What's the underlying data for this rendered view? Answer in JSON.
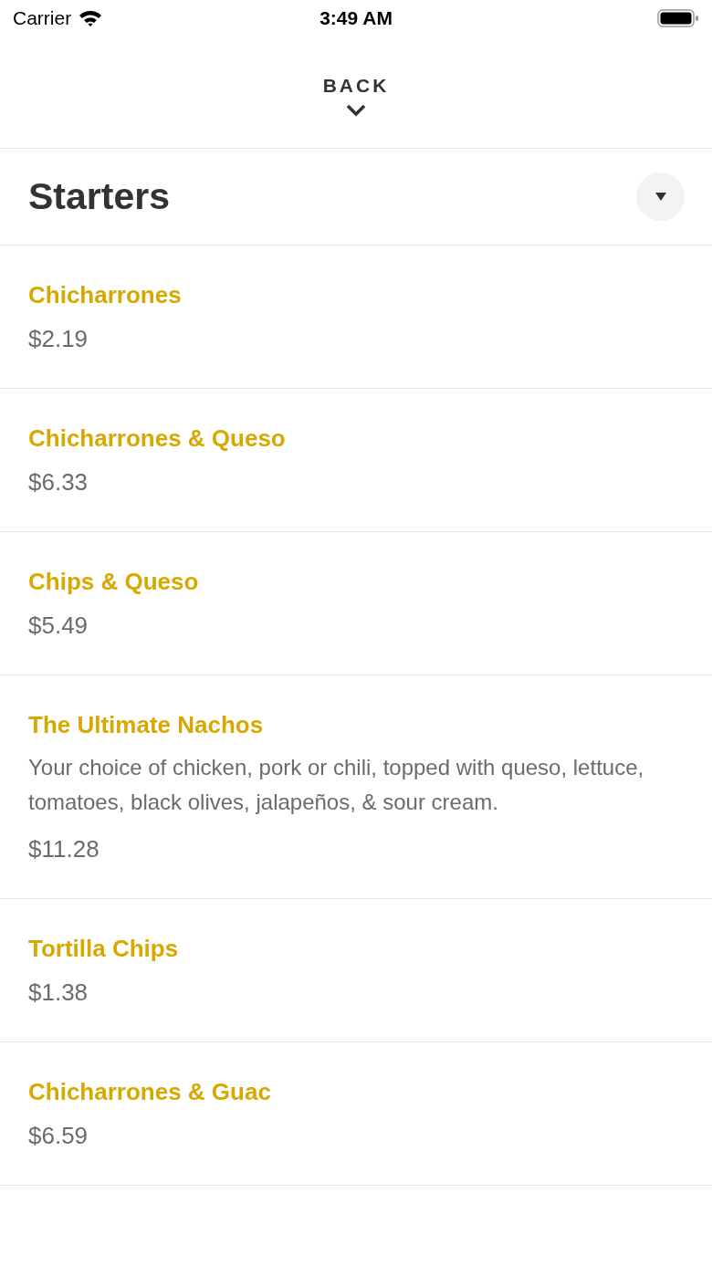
{
  "status_bar": {
    "carrier": "Carrier",
    "time": "3:49 AM"
  },
  "nav": {
    "back_label": "BACK"
  },
  "section": {
    "title": "Starters",
    "expanded": false
  },
  "items": [
    {
      "name": "Chicharrones",
      "price": "$2.19"
    },
    {
      "name": "Chicharrones & Queso",
      "price": "$6.33"
    },
    {
      "name": "Chips & Queso",
      "price": "$5.49"
    },
    {
      "name": "The Ultimate Nachos",
      "description": "Your choice of chicken, pork or chili, topped with queso, lettuce, tomatoes, black olives, jalapeños, & sour cream.",
      "price": "$11.28"
    },
    {
      "name": "Tortilla Chips",
      "price": "$1.38"
    },
    {
      "name": "Chicharrones & Guac",
      "price": "$6.59"
    }
  ]
}
